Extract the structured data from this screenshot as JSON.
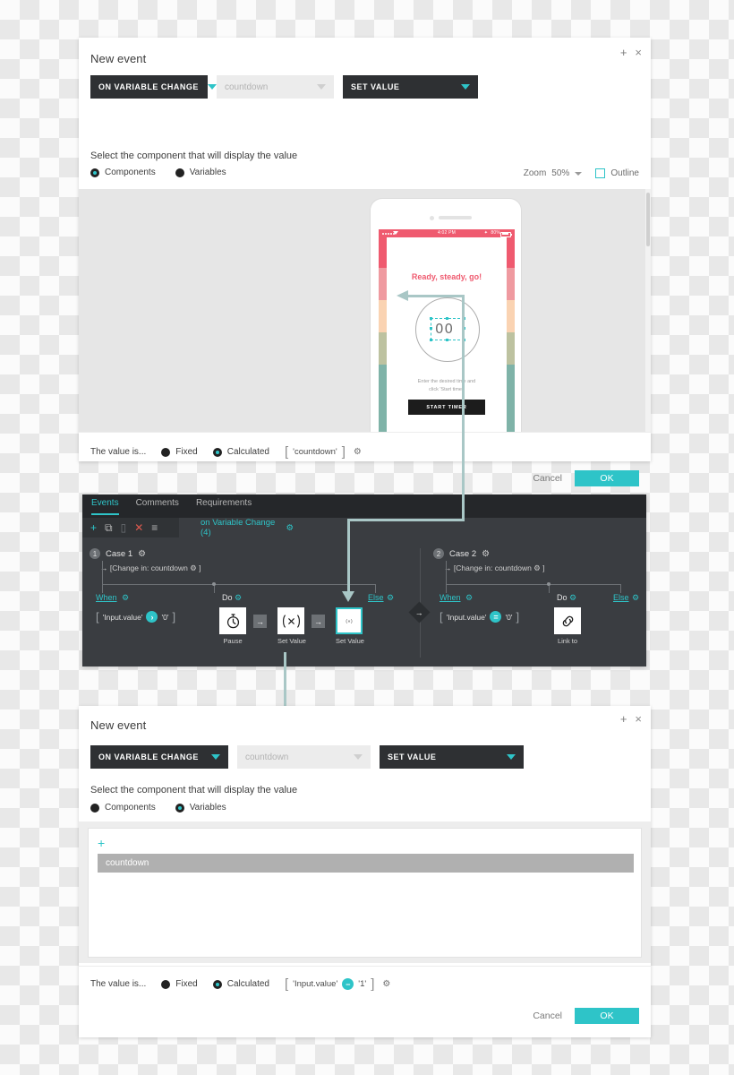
{
  "dialog_top": {
    "title": "New event",
    "window_controls": {
      "add": "+",
      "close": "×"
    },
    "selects": {
      "trigger": "ON VARIABLE CHANGE",
      "target": "countdown",
      "action": "SET VALUE"
    },
    "helper_text": "Select the component that will display the value",
    "radios": [
      {
        "label": "Components",
        "selected": true
      },
      {
        "label": "Variables",
        "selected": false
      }
    ],
    "zoom": {
      "label": "Zoom",
      "value": "50%"
    },
    "outline": {
      "label": "Outline",
      "checked": false
    },
    "footer": {
      "value_label": "The value is...",
      "options": [
        {
          "label": "Fixed",
          "selected": false
        },
        {
          "label": "Calculated",
          "selected": true
        }
      ],
      "expression": {
        "open": "[",
        "operand": "'countdown'",
        "close": "]",
        "gear": "⚙"
      },
      "cancel": "Cancel",
      "ok": "OK"
    }
  },
  "phone_preview": {
    "status_bar": {
      "time": "4:02 PM",
      "battery": "80%"
    },
    "app_title": "Ready, steady, go!",
    "timer_value": "00",
    "hint_line1": "Enter the desired time and",
    "hint_line2": "click 'Start timer'",
    "button_label": "START TIMER",
    "stripe_colors": [
      "#ef5a6f",
      "#ef9aa0",
      "#fad3b2",
      "#bdc2a0",
      "#7fb3a8"
    ],
    "accent_color": "#ef5a6f"
  },
  "events_panel": {
    "tabs": [
      {
        "label": "Events",
        "active": true
      },
      {
        "label": "Comments",
        "active": false
      },
      {
        "label": "Requirements",
        "active": false
      }
    ],
    "toolbar_icons": [
      "add-icon",
      "duplicate-icon",
      "paste-icon",
      "delete-icon",
      "sort-icon"
    ],
    "event_tab": {
      "label": "on Variable Change (4)",
      "gear": "⚙"
    },
    "cases": [
      {
        "number": "1",
        "title": "Case 1",
        "gear": "⚙",
        "condition": "→ [Change in:  countdown  ⚙  ]",
        "when_label": "When",
        "do_label": "Do",
        "else_label": "Else",
        "when_expr": {
          "open": "[",
          "left": "'Input.value'",
          "op": "›",
          "right": "'0'",
          "close": "]"
        },
        "actions": [
          {
            "label": "Pause",
            "icon": "stopwatch-icon",
            "selected": false
          },
          {
            "label": "Set Value",
            "icon": "set-value-icon",
            "selected": false
          },
          {
            "label": "Set Value",
            "icon": "set-value-icon",
            "selected": true
          }
        ]
      },
      {
        "number": "2",
        "title": "Case 2",
        "gear": "⚙",
        "condition": "→ [Change in:  countdown  ⚙  ]",
        "when_label": "When",
        "do_label": "Do",
        "else_label": "Else",
        "when_expr": {
          "open": "[",
          "left": "'Input.value'",
          "op": "=",
          "right": "'0'",
          "close": "]"
        },
        "actions": [
          {
            "label": "Link to",
            "icon": "link-icon",
            "selected": false
          }
        ]
      }
    ]
  },
  "dialog_bottom": {
    "title": "New event",
    "window_controls": {
      "add": "+",
      "close": "×"
    },
    "selects": {
      "trigger": "ON VARIABLE CHANGE",
      "target": "countdown",
      "action": "SET VALUE"
    },
    "helper_text": "Select the component that will display the value",
    "radios": [
      {
        "label": "Components",
        "selected": false
      },
      {
        "label": "Variables",
        "selected": true
      }
    ],
    "list": {
      "add_icon": "+",
      "items": [
        {
          "label": "countdown",
          "selected": true
        }
      ]
    },
    "footer": {
      "value_label": "The value is...",
      "options": [
        {
          "label": "Fixed",
          "selected": false
        },
        {
          "label": "Calculated",
          "selected": true
        }
      ],
      "expression": {
        "open": "[",
        "left": "'Input.value'",
        "op": "−",
        "right": "'1'",
        "close": "]",
        "gear": "⚙"
      },
      "cancel": "Cancel",
      "ok": "OK"
    }
  },
  "theme": {
    "accent": "#2ec4c8",
    "dark_panel": "#3a3d41",
    "dark_select": "#2e3033",
    "connector": "#a9c7c6"
  }
}
